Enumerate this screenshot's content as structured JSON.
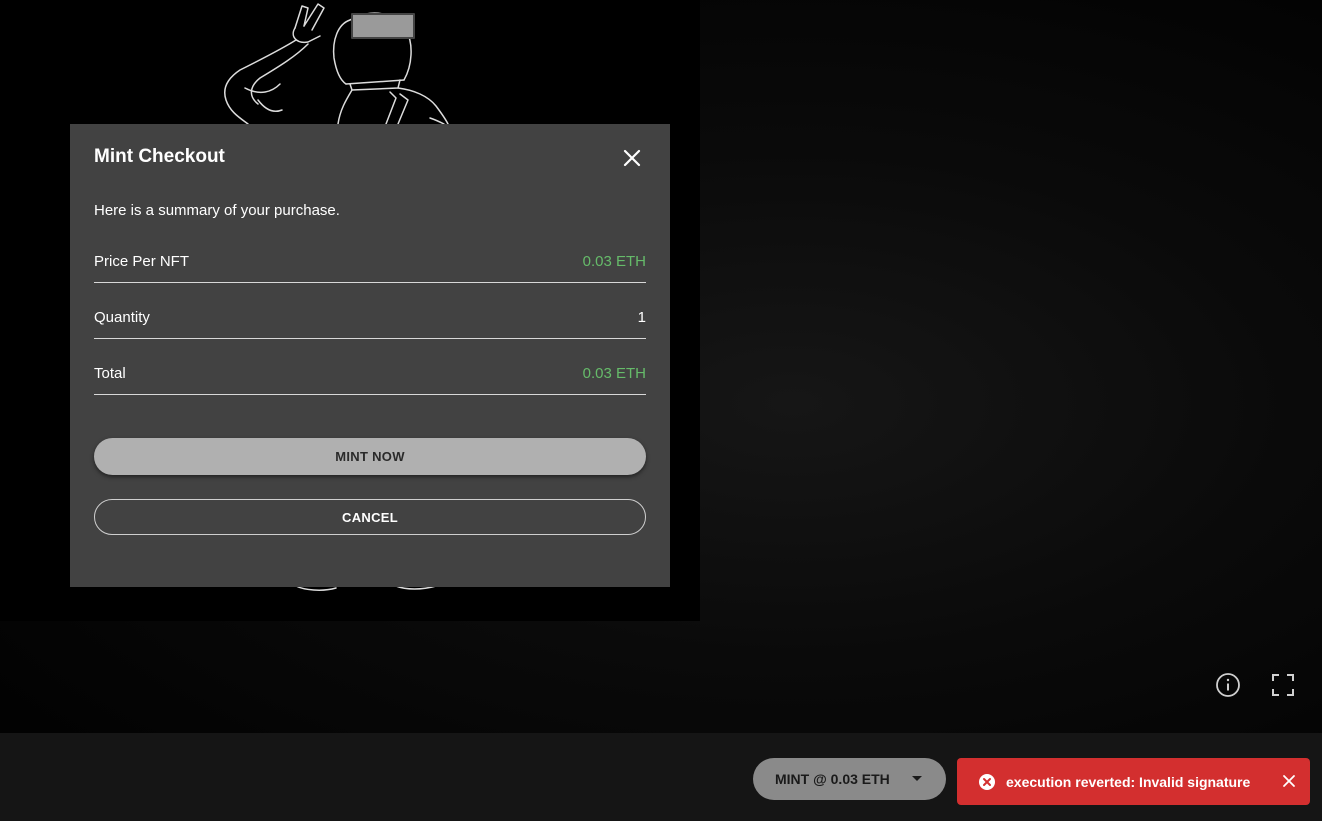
{
  "modal": {
    "title": "Mint Checkout",
    "subtitle": "Here is a summary of your purchase.",
    "rows": [
      {
        "label": "Price Per NFT",
        "value": "0.03 ETH"
      },
      {
        "label": "Quantity",
        "value": "1"
      },
      {
        "label": "Total",
        "value": "0.03 ETH"
      }
    ],
    "mint_button": "MINT NOW",
    "cancel_button": "CANCEL",
    "close_icon": "close-icon"
  },
  "viewer": {
    "info_icon": "info-icon",
    "fullscreen_icon": "fullscreen-icon"
  },
  "bottom_bar": {
    "mint_dropdown_label": "MINT @ 0.03 ETH",
    "dropdown_icon": "caret-down-icon"
  },
  "toast": {
    "message": "execution reverted: Invalid signature",
    "icon": "error-circle-icon",
    "close_icon": "close-icon"
  },
  "colors": {
    "accent_green": "#66bb6a",
    "error_red": "#d32f2f",
    "modal_bg": "#424242"
  }
}
